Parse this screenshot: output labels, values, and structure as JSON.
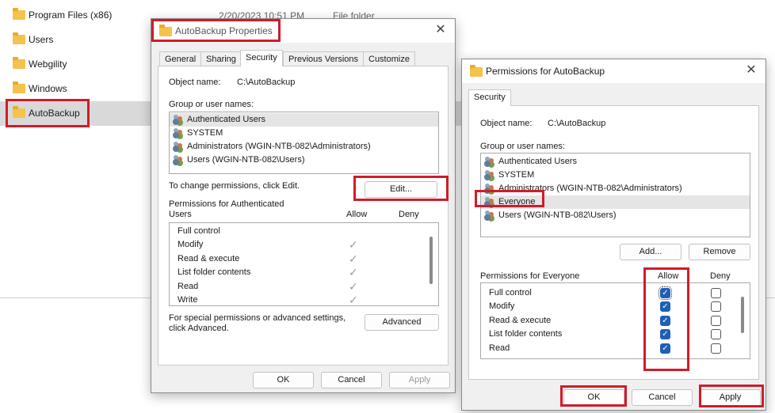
{
  "explorer": {
    "top_row_date": "2/20/2023 10:51 PM",
    "top_row_type": "File folder",
    "items": [
      {
        "name": "Program Files (x86)"
      },
      {
        "name": "Users"
      },
      {
        "name": "Webgility"
      },
      {
        "name": "Windows"
      },
      {
        "name": "AutoBackup"
      }
    ]
  },
  "props_dialog": {
    "title": "AutoBackup Properties",
    "close_glyph": "✕",
    "tabs": [
      "General",
      "Sharing",
      "Security",
      "Previous Versions",
      "Customize"
    ],
    "object_name_label": "Object name:",
    "object_name_value": "C:\\AutoBackup",
    "group_label": "Group or user names:",
    "users": [
      "Authenticated Users",
      "SYSTEM",
      "Administrators (WGIN-NTB-082\\Administrators)",
      "Users (WGIN-NTB-082\\Users)"
    ],
    "change_hint": "To change permissions, click Edit.",
    "edit_button": "Edit...",
    "perm_for_line1": "Permissions for Authenticated",
    "perm_for_line2": "Users",
    "allow_header": "Allow",
    "deny_header": "Deny",
    "permissions": [
      "Full control",
      "Modify",
      "Read & execute",
      "List folder contents",
      "Read",
      "Write"
    ],
    "special_line1": "For special permissions or advanced settings,",
    "special_line2": "click Advanced.",
    "advanced_button": "Advanced",
    "ok_button": "OK",
    "cancel_button": "Cancel",
    "apply_button": "Apply",
    "check_glyph": "✓"
  },
  "perm_dialog": {
    "title": "Permissions for AutoBackup",
    "close_glyph": "✕",
    "tab": "Security",
    "object_name_label": "Object name:",
    "object_name_value": "C:\\AutoBackup",
    "group_label": "Group or user names:",
    "users": [
      "Authenticated Users",
      "SYSTEM",
      "Administrators (WGIN-NTB-082\\Administrators)",
      "Everyone",
      "Users (WGIN-NTB-082\\Users)"
    ],
    "add_button": "Add...",
    "remove_button": "Remove",
    "perm_for": "Permissions for Everyone",
    "allow_header": "Allow",
    "deny_header": "Deny",
    "permissions": [
      "Full control",
      "Modify",
      "Read & execute",
      "List folder contents",
      "Read"
    ],
    "ok_button": "OK",
    "cancel_button": "Cancel",
    "apply_button": "Apply",
    "check_glyph": "✓"
  }
}
